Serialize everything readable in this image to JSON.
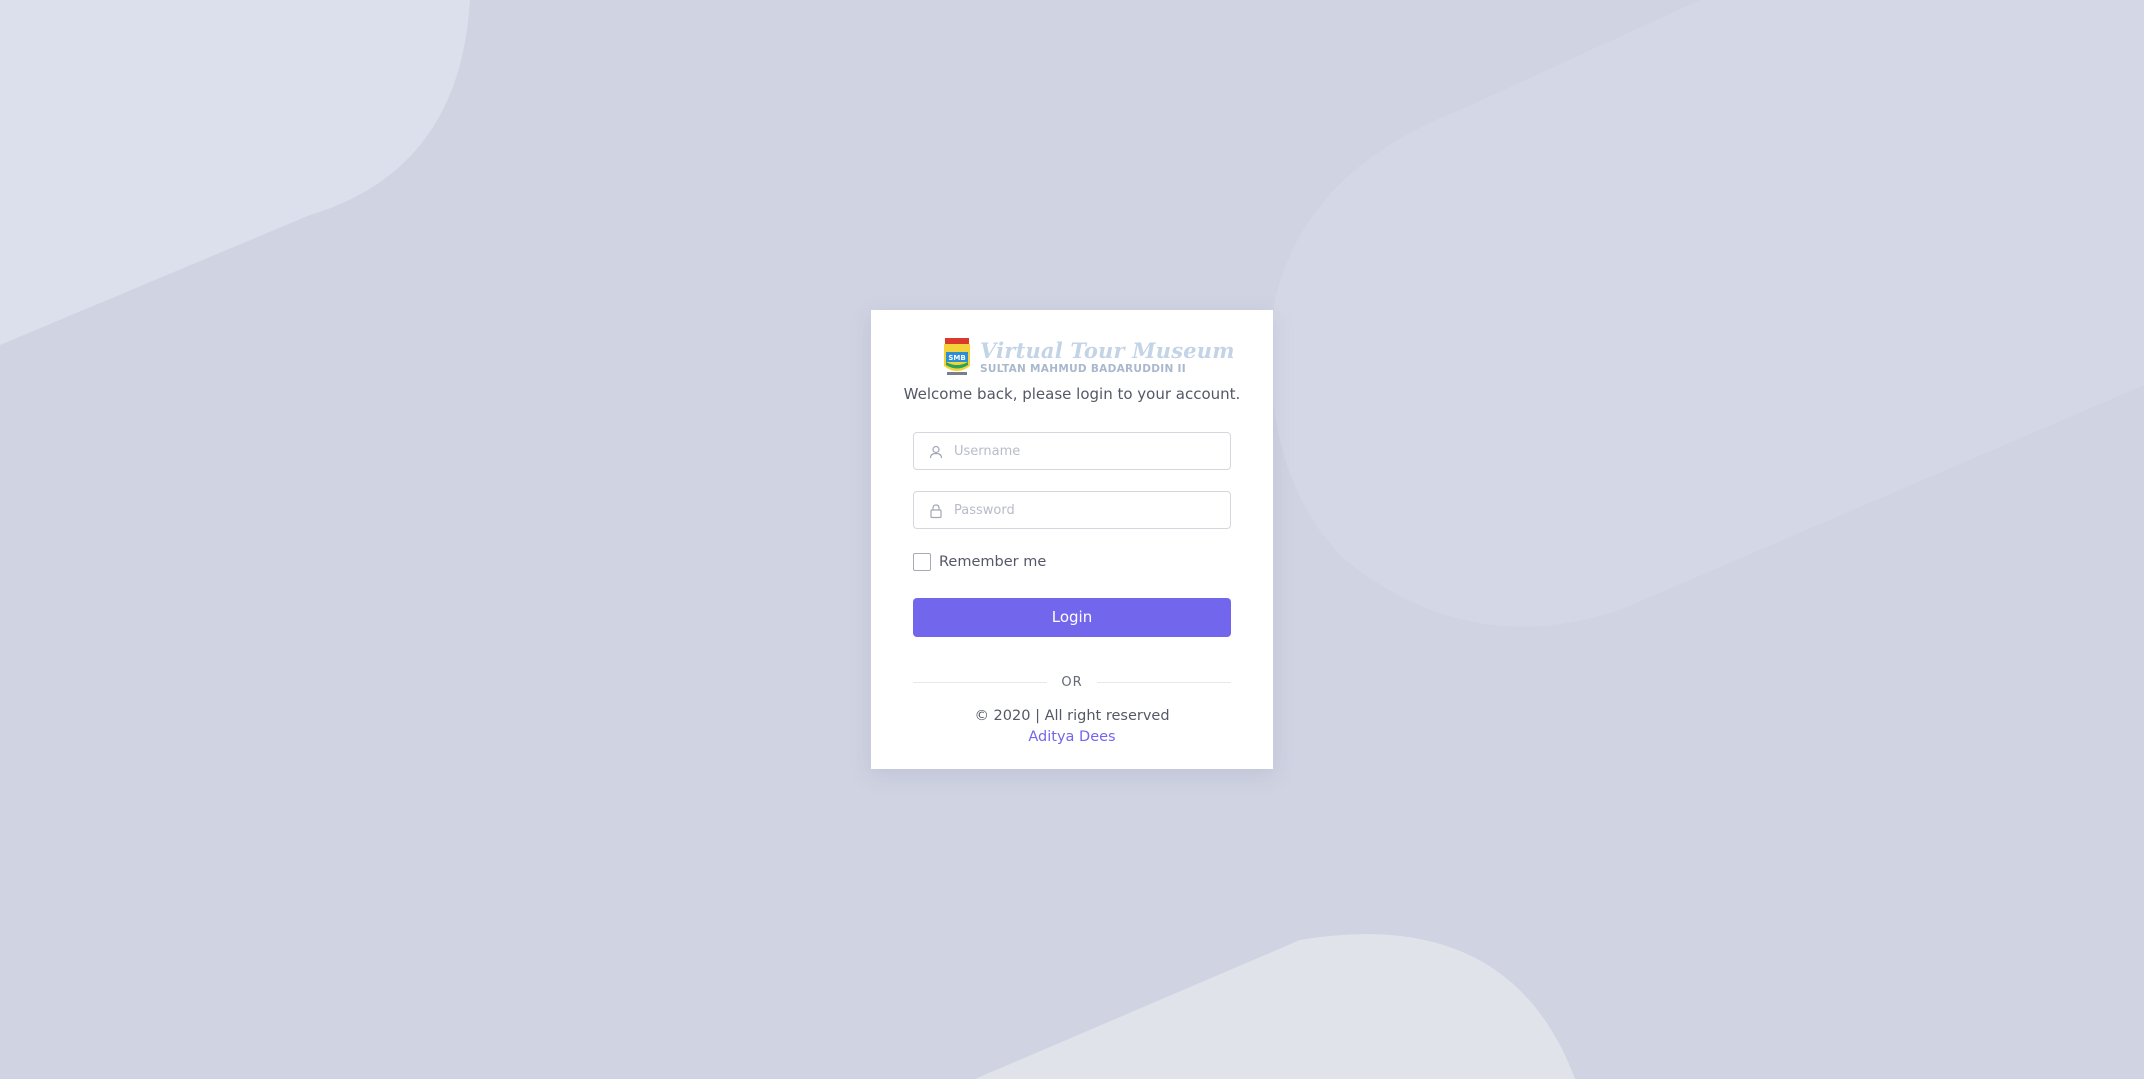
{
  "logo": {
    "title": "Virtual Tour Museum",
    "subtitle": "SULTAN MAHMUD BADARUDDIN II",
    "emblem_text": "SMB"
  },
  "welcome_text": "Welcome back, please login to your account.",
  "form": {
    "username": {
      "placeholder": "Username",
      "value": "",
      "icon": "user-icon"
    },
    "password": {
      "placeholder": "Password",
      "value": "",
      "icon": "lock-icon"
    },
    "remember_label": "Remember me",
    "remember_checked": false,
    "login_label": "Login"
  },
  "divider_text": "OR",
  "footer": {
    "copyright": "© 2020 | All right reserved",
    "author": "Aditya Dees"
  },
  "colors": {
    "background": "#cfd3e2",
    "accent": "#7266ec",
    "card": "#ffffff"
  }
}
